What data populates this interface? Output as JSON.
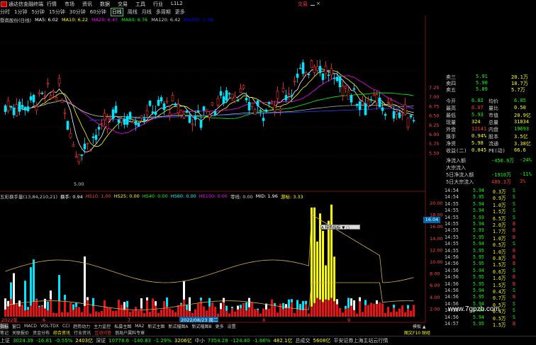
{
  "menubar": {
    "app_title": "通达信金融终端",
    "items": [
      "行情",
      "市场",
      "资讯",
      "数据",
      "交易",
      "工具",
      "行业",
      "L1L2"
    ],
    "right_label": "交易",
    "close_glyph": "×"
  },
  "periodbar": {
    "tabs": [
      "分时",
      "1分钟",
      "5分钟",
      "15分钟",
      "30分钟",
      "60分钟",
      "日线",
      "周线",
      "月线",
      "多周期",
      "更多"
    ],
    "active": 6
  },
  "ma_legend": [
    {
      "text": "暨南股份(日线)",
      "color": "#cccccc"
    },
    {
      "text": "MA5: 6.02",
      "color": "#ffffff"
    },
    {
      "text": "MA10: 6.22",
      "color": "#ffff00"
    },
    {
      "text": "MA20: 6.47",
      "color": "#ff00ff"
    },
    {
      "text": "MA60: 6.76",
      "color": "#00ff00"
    },
    {
      "text": "MA120: 6.42",
      "color": "#cccccc"
    },
    {
      "text": "MA250: 5.98",
      "color": "#0000ff"
    }
  ],
  "price_axis": {
    "ticks": [
      "7.25",
      "7.00",
      "6.75",
      "6.50",
      "6.25",
      "6.00",
      "5.75",
      "5.50"
    ]
  },
  "chart_data": [
    {
      "type": "candlestick",
      "title": "暨南股份(日线)",
      "low_label": "5.00",
      "xlabel": "",
      "ylabel": ""
    },
    {
      "type": "bar",
      "title": "五彩换手量(13,84,210,21)",
      "yticks": [
        "20.00",
        "18.00",
        "16.00",
        "14.00",
        "12.00",
        "10.00",
        "8.00",
        "6.00",
        "4.00",
        "2.00"
      ],
      "current_tag": "16.04",
      "date_label": "2022/08/23 周二",
      "month_ticks": [
        "2022年",
        "6",
        "7",
        "8",
        "9"
      ]
    }
  ],
  "volume_legend": [
    {
      "text": "五彩换手量(13,84,210,21)",
      "color": "#cccccc"
    },
    {
      "text": "换手: 0.94",
      "color": "#ffffff"
    },
    {
      "text": "HS10: 1.00",
      "color": "#ff4444"
    },
    {
      "text": "HS25: 0.00",
      "color": "#ffff00"
    },
    {
      "text": "HS40: 0.00",
      "color": "#00ff00"
    },
    {
      "text": "HS60: 0.00",
      "color": "#00ffff"
    },
    {
      "text": "HS100: 0.00",
      "color": "#ff00ff"
    },
    {
      "text": "零线: 0.00",
      "color": "#cccccc"
    },
    {
      "text": "MID: 1.96",
      "color": "#ffffff"
    },
    {
      "text": "游标: 3.33",
      "color": "#ffff00"
    }
  ],
  "tooltip": {
    "label": "A 特色指标 ▼ ▢"
  },
  "quote": {
    "ask_rows": [
      {
        "label": "卖三",
        "price": "5.91",
        "vol": "20.1万"
      },
      {
        "label": "卖四",
        "price": "5.90",
        "vol": "18.7万"
      },
      {
        "label": "卖五",
        "price": "5.89",
        "vol": "5.7万"
      }
    ],
    "stats": [
      {
        "l1": "今开",
        "v1": "6.02",
        "l2": "均价",
        "v2": "6.05",
        "c1": "#00ff00",
        "c2": "#00ff00"
      },
      {
        "l1": "最高",
        "v1": "6.07",
        "l2": "量比",
        "v2": "0.50",
        "c1": "#ff3333",
        "c2": "#ffff00"
      },
      {
        "l1": "最低",
        "v1": "5.93",
        "l2": "市值",
        "v2": "20.9亿",
        "c1": "#00ff00",
        "c2": "#ffff00"
      },
      {
        "l1": "现量",
        "v1": "324",
        "l2": "总量",
        "v2": "31834",
        "c1": "#ffff00",
        "c2": "#ffff00"
      },
      {
        "l1": "外盘",
        "v1": "12141",
        "l2": "内盘",
        "v2": "19693",
        "c1": "#ff3333",
        "c2": "#00ff00"
      },
      {
        "l1": "换手",
        "v1": "0.94%",
        "l2": "股本",
        "v2": "3.5亿",
        "c1": "#ffff00",
        "c2": "#ffff00"
      },
      {
        "l1": "净资",
        "v1": "5.98",
        "l2": "流通",
        "v2": "3.38亿",
        "c1": "#ffff00",
        "c2": "#ffff00"
      },
      {
        "l1": "收益(二)",
        "v1": "0.045",
        "l2": "PE(动)",
        "v2": "66.6",
        "c1": "#ffff00",
        "c2": "#ffff00"
      }
    ],
    "flows": [
      {
        "label": "净流入额",
        "value": "-450.9万",
        "pct": "-24%",
        "color": "#00ff00"
      },
      {
        "label": "大宗流入",
        "value": "",
        "pct": "",
        "color": "#cccccc"
      },
      {
        "label": "5日净流入额",
        "value": "-1910万",
        "pct": "-11%",
        "color": "#00ff00"
      },
      {
        "label": "5日大宗流入",
        "value": "489.3万",
        "pct": "3%",
        "color": "#ff3333"
      }
    ]
  },
  "trades": [
    {
      "time": "14:54",
      "price": "5.94",
      "vol": "0.3万",
      "bs": "S"
    },
    {
      "time": "14:54",
      "price": "5.95",
      "vol": "0.9万",
      "bs": "S"
    },
    {
      "time": "14:55",
      "price": "5.94",
      "vol": "1.0万",
      "bs": "S"
    },
    {
      "time": "14:55",
      "price": "5.94",
      "vol": "1.5万",
      "bs": "S"
    },
    {
      "time": "14:55",
      "price": "5.93",
      "vol": "6.5万",
      "bs": "S"
    },
    {
      "time": "14:55",
      "price": "5.94",
      "vol": "2.0万",
      "bs": "B"
    },
    {
      "time": "14:55",
      "price": "5.93",
      "vol": "1.7万",
      "bs": "B"
    },
    {
      "time": "14:55",
      "price": "5.95",
      "vol": "1.0万",
      "bs": "B"
    },
    {
      "time": "14:55",
      "price": "5.94",
      "vol": "0.5万",
      "bs": "S"
    },
    {
      "time": "14:55",
      "price": "5.95",
      "vol": "1.0万",
      "bs": "B"
    },
    {
      "time": "14:56",
      "price": "5.95",
      "vol": "0.8万",
      "bs": "B"
    },
    {
      "time": "14:56",
      "price": "5.95",
      "vol": "1.5万",
      "bs": "B"
    },
    {
      "time": "14:56",
      "price": "5.94",
      "vol": "0.6万",
      "bs": "S"
    },
    {
      "time": "14:56",
      "price": "5.95",
      "vol": "1.6万",
      "bs": "B"
    },
    {
      "time": "14:56",
      "price": "5.95",
      "vol": "1.5万",
      "bs": "B"
    },
    {
      "time": "14:56",
      "price": "5.94",
      "vol": "0.4万",
      "bs": "S"
    },
    {
      "time": "14:56",
      "price": "5.95",
      "vol": "0.7万",
      "bs": "B"
    },
    {
      "time": "14:56",
      "price": "5.94",
      "vol": "0.5万",
      "bs": "S"
    },
    {
      "time": "14:56",
      "price": "5.94",
      "vol": "0.4万",
      "bs": "S"
    },
    {
      "time": "14:56",
      "price": "5.94",
      "vol": "0.5万",
      "bs": "S"
    },
    {
      "time": "14:57",
      "price": "5.95",
      "vol": "1.5万",
      "bs": "B"
    }
  ],
  "bottom_tabs": [
    "指标",
    "窗口",
    "MACD",
    "VOL-TDX",
    "CCI",
    "趋势动力",
    "主力监控",
    "私募主图",
    "MA2",
    "新式主图",
    "新式幅图A",
    "新式幅图B",
    "更多",
    "设置"
  ],
  "bottom_tabs_active": 0,
  "bottom_right": "模板 ▲",
  "bottom_tabs2": [
    {
      "text": "笔记",
      "color": "#cccccc"
    },
    {
      "text": "关联报价",
      "color": "#cccccc"
    },
    {
      "text": "资金分布",
      "color": "#cccccc"
    },
    {
      "text": "综合资讯",
      "color": "#ffff00"
    },
    {
      "text": "行业资讯",
      "color": "#cccccc"
    },
    {
      "text": "互动问答",
      "color": "#ff3333"
    },
    {
      "text": "翁局户属料专章",
      "color": "#cccccc"
    }
  ],
  "bottom_tabs2_right": "图文F10 财经",
  "status": [
    {
      "text": "上证",
      "color": "#cccccc"
    },
    {
      "text": "3024.39",
      "color": "#00ff00"
    },
    {
      "text": "-16.81",
      "color": "#00ff00"
    },
    {
      "text": "-0.55%",
      "color": "#00ff00"
    },
    {
      "text": "2403亿",
      "color": "#ffff00"
    },
    {
      "text": "深证",
      "color": "#cccccc"
    },
    {
      "text": "10778.6",
      "color": "#00ff00"
    },
    {
      "text": "-140.83",
      "color": "#00ff00"
    },
    {
      "text": "-1.29%",
      "color": "#00ff00"
    },
    {
      "text": "3206亿",
      "color": "#ffff00"
    },
    {
      "text": "中小",
      "color": "#cccccc"
    },
    {
      "text": "7354.28",
      "color": "#00ff00"
    },
    {
      "text": "-124.40",
      "color": "#00ff00"
    },
    {
      "text": "-1.66%",
      "color": "#00ff00"
    },
    {
      "text": "482.1亿",
      "color": "#ffff00"
    },
    {
      "text": "总成交",
      "color": "#cccccc"
    },
    {
      "text": "5608亿",
      "color": "#ffff00"
    },
    {
      "text": "平安证券上海主站云行情",
      "color": "#cccccc"
    }
  ],
  "watermark": "www.7gpzb.com"
}
